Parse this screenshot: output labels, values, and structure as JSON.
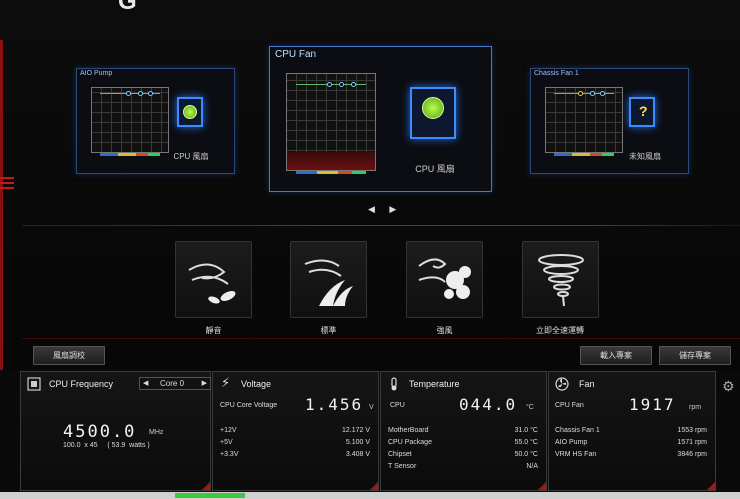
{
  "fans": {
    "aio": {
      "title": "AIO Pump",
      "label": "CPU 風扇"
    },
    "cpu": {
      "title": "CPU Fan",
      "label": "CPU 風扇"
    },
    "chassis": {
      "title": "Chassis Fan 1",
      "label": "未知風扇"
    }
  },
  "nav": {
    "arrows": "◀ ▶"
  },
  "presets": [
    {
      "label": "靜音",
      "icon": "wind-leaves-icon"
    },
    {
      "label": "標準",
      "icon": "wind-grass-icon"
    },
    {
      "label": "強風",
      "icon": "strong-wind-icon"
    },
    {
      "label": "立即全速運轉",
      "icon": "tornado-icon"
    }
  ],
  "buttons": {
    "fan_tuning": "風扇調校",
    "load_profile": "載入專案",
    "save_profile": "儲存專案"
  },
  "cpu_freq": {
    "title": "CPU Frequency",
    "core_select": "Core 0",
    "value": "4500.0",
    "unit": "MHz",
    "detail": "100.0  x 45     ( 53.9  watts )"
  },
  "voltage": {
    "title": "Voltage",
    "main_label": "CPU Core Voltage",
    "main_value": "1.456",
    "main_unit": "V",
    "rows": [
      {
        "label": "+12V",
        "value": "12.172  V"
      },
      {
        "label": "+5V",
        "value": "5.100  V"
      },
      {
        "label": "+3.3V",
        "value": "3.408  V"
      }
    ]
  },
  "temperature": {
    "title": "Temperature",
    "main_label": "CPU",
    "main_value": "044.0",
    "main_unit": "°C",
    "rows": [
      {
        "label": "MotherBoard",
        "value": "31.0 °C"
      },
      {
        "label": "CPU Package",
        "value": "55.0 °C"
      },
      {
        "label": "Chipset",
        "value": "50.0 °C"
      },
      {
        "label": "T Sensor",
        "value": "N/A"
      }
    ]
  },
  "fan_speed": {
    "title": "Fan",
    "main_label": "CPU Fan",
    "main_value": "1917",
    "main_unit": "rpm",
    "rows": [
      {
        "label": "Chassis Fan 1",
        "value": "1553  rpm"
      },
      {
        "label": "AIO Pump",
        "value": "1571  rpm"
      },
      {
        "label": "VRM HS Fan",
        "value": "3846  rpm"
      }
    ]
  },
  "colors": {
    "accent_red": "#a01818",
    "panel_blue": "#3a8cff",
    "fan_green": "#8ad83a"
  }
}
